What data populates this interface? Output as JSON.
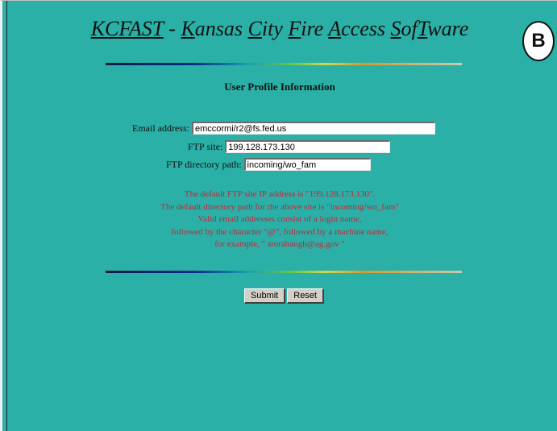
{
  "header": {
    "title_parts": [
      {
        "text": "KCFAST",
        "underline": true
      },
      {
        "text": " - ",
        "underline": false
      },
      {
        "text": "K",
        "underline": true
      },
      {
        "text": "ansas ",
        "underline": false
      },
      {
        "text": "C",
        "underline": true
      },
      {
        "text": "ity ",
        "underline": false
      },
      {
        "text": "F",
        "underline": true
      },
      {
        "text": "ire ",
        "underline": false
      },
      {
        "text": "A",
        "underline": true
      },
      {
        "text": "ccess ",
        "underline": false
      },
      {
        "text": "S",
        "underline": true
      },
      {
        "text": "of",
        "underline": false
      },
      {
        "text": "T",
        "underline": true
      },
      {
        "text": "ware",
        "underline": false
      }
    ],
    "badge": "B"
  },
  "form": {
    "heading": "User Profile Information",
    "email_label": "Email address:",
    "email_value": "emccormi/r2@fs.fed.us",
    "ftp_label": "FTP site:",
    "ftp_value": "199.128.173.130",
    "dir_label": "FTP directory path:",
    "dir_value": "incoming/wo_fam"
  },
  "info": {
    "lines": [
      "The default FTP site IP address is \"199.128.173.130\".",
      "The default directory path for the above site is \"incoming/wo_fam\"",
      "Valid email addresses consist of a login name,",
      "followed by the character \"@\", followed by a machine name,",
      "for example, \" srorabaugh@ag.gov \""
    ]
  },
  "buttons": {
    "submit_label": "Submit",
    "reset_label": "Reset"
  },
  "colors": {
    "background": "#2ab0a7",
    "info_text": "#c2273b"
  }
}
